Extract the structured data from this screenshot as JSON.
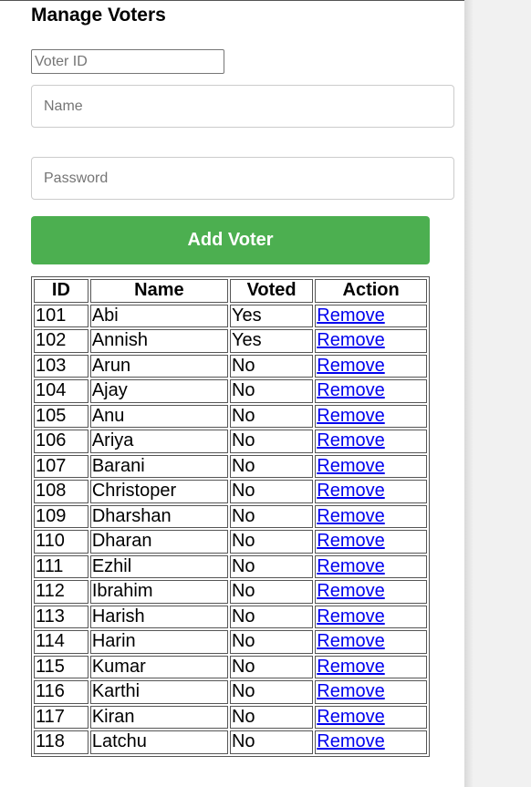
{
  "page": {
    "title": "Manage Voters"
  },
  "form": {
    "voter_id_placeholder": "Voter ID",
    "name_placeholder": "Name",
    "password_placeholder": "Password",
    "submit_label": "Add Voter"
  },
  "table": {
    "headers": [
      "ID",
      "Name",
      "Voted",
      "Action"
    ],
    "rows": [
      {
        "id": "101",
        "name": "Abi",
        "voted": "Yes",
        "action": "Remove"
      },
      {
        "id": "102",
        "name": "Annish",
        "voted": "Yes",
        "action": "Remove"
      },
      {
        "id": "103",
        "name": "Arun",
        "voted": "No",
        "action": "Remove"
      },
      {
        "id": "104",
        "name": "Ajay",
        "voted": "No",
        "action": "Remove"
      },
      {
        "id": "105",
        "name": "Anu",
        "voted": "No",
        "action": "Remove"
      },
      {
        "id": "106",
        "name": "Ariya",
        "voted": "No",
        "action": "Remove"
      },
      {
        "id": "107",
        "name": "Barani",
        "voted": "No",
        "action": "Remove"
      },
      {
        "id": "108",
        "name": "Christoper",
        "voted": "No",
        "action": "Remove"
      },
      {
        "id": "109",
        "name": "Dharshan",
        "voted": "No",
        "action": "Remove"
      },
      {
        "id": "110",
        "name": "Dharan",
        "voted": "No",
        "action": "Remove"
      },
      {
        "id": "111",
        "name": "Ezhil",
        "voted": "No",
        "action": "Remove"
      },
      {
        "id": "112",
        "name": "Ibrahim",
        "voted": "No",
        "action": "Remove"
      },
      {
        "id": "113",
        "name": "Harish",
        "voted": "No",
        "action": "Remove"
      },
      {
        "id": "114",
        "name": "Harin",
        "voted": "No",
        "action": "Remove"
      },
      {
        "id": "115",
        "name": "Kumar",
        "voted": "No",
        "action": "Remove"
      },
      {
        "id": "116",
        "name": "Karthi",
        "voted": "No",
        "action": "Remove"
      },
      {
        "id": "117",
        "name": "Kiran",
        "voted": "No",
        "action": "Remove"
      },
      {
        "id": "118",
        "name": "Latchu",
        "voted": "No",
        "action": "Remove"
      }
    ]
  },
  "colors": {
    "accent": "#4caf50",
    "link": "#0000ee"
  }
}
